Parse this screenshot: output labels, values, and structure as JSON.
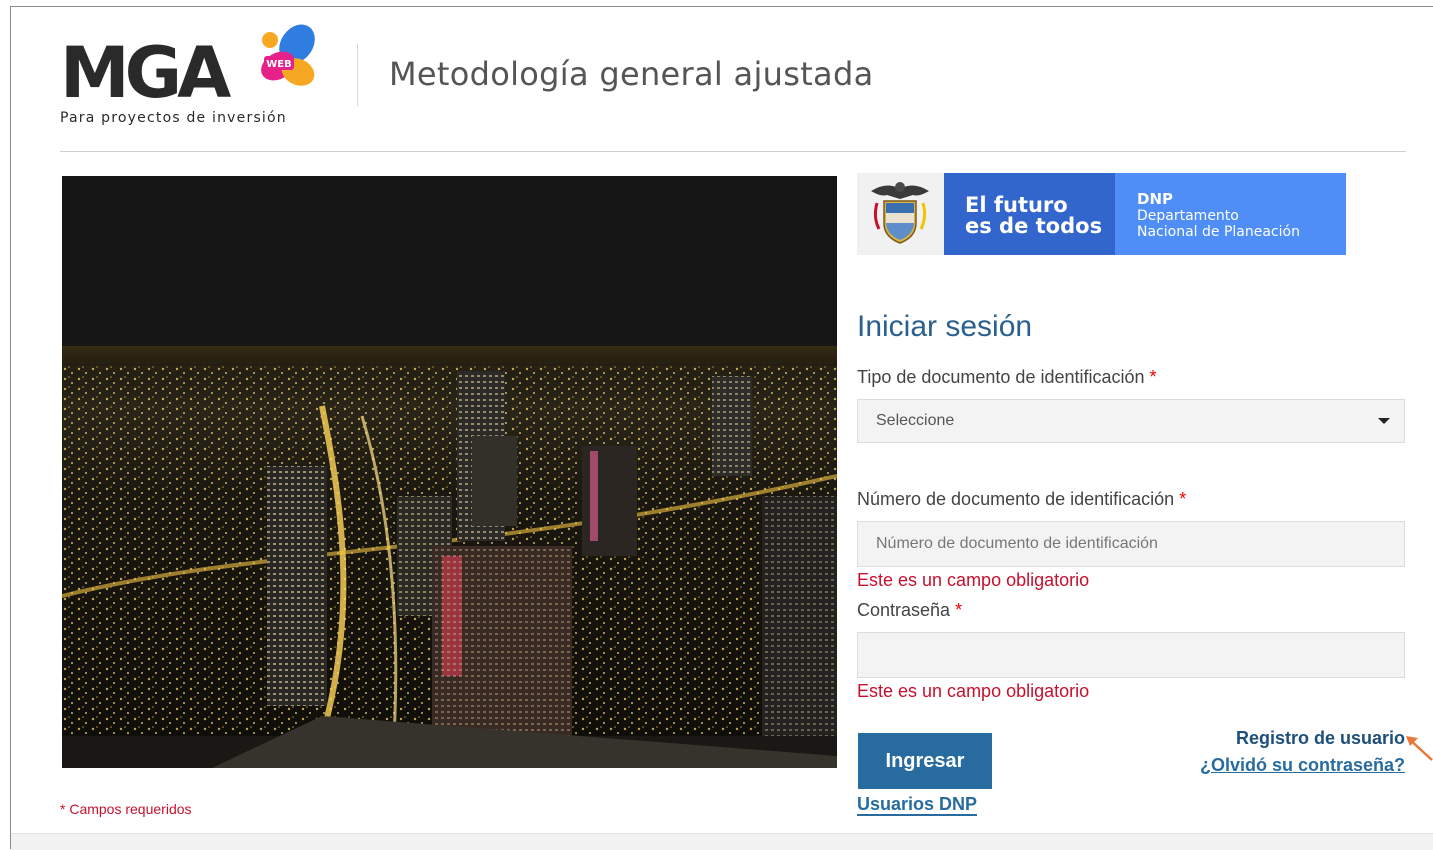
{
  "header": {
    "logo_text": "MGA",
    "logo_badge": "WEB",
    "logo_subtitle": "Para proyectos de inversión",
    "app_title": "Metodología general ajustada"
  },
  "banner": {
    "slogan_line1": "El futuro",
    "slogan_line2": "es de todos",
    "org_abbr": "DNP",
    "org_line1": "Departamento",
    "org_line2": "Nacional de Planeación",
    "colors": {
      "mid": "#3366cc",
      "right": "#4f8df7"
    }
  },
  "form": {
    "title": "Iniciar sesión",
    "doc_type_label": "Tipo de documento de identificación",
    "doc_type_value": "Seleccione",
    "doc_number_label": "Número de documento de identificación",
    "doc_number_placeholder": "Número de documento de identificación",
    "doc_number_error": "Este es un campo obligatorio",
    "password_label": "Contraseña",
    "password_error": "Este es un campo obligatorio",
    "required_marker": "*",
    "submit_label": "Ingresar",
    "dnp_users_link": "Usuarios DNP",
    "register_link": "Registro de usuario",
    "forgot_link": "¿Olvidó su contraseña?",
    "required_note": "* Campos requeridos"
  },
  "icons": {
    "shield": "colombia-coat-of-arms-icon",
    "caret": "caret-down-icon",
    "arrow": "annotation-arrow-icon"
  },
  "colors": {
    "accent": "#286c9f",
    "error": "#c8102e",
    "annotation_arrow": "#e8773a"
  }
}
